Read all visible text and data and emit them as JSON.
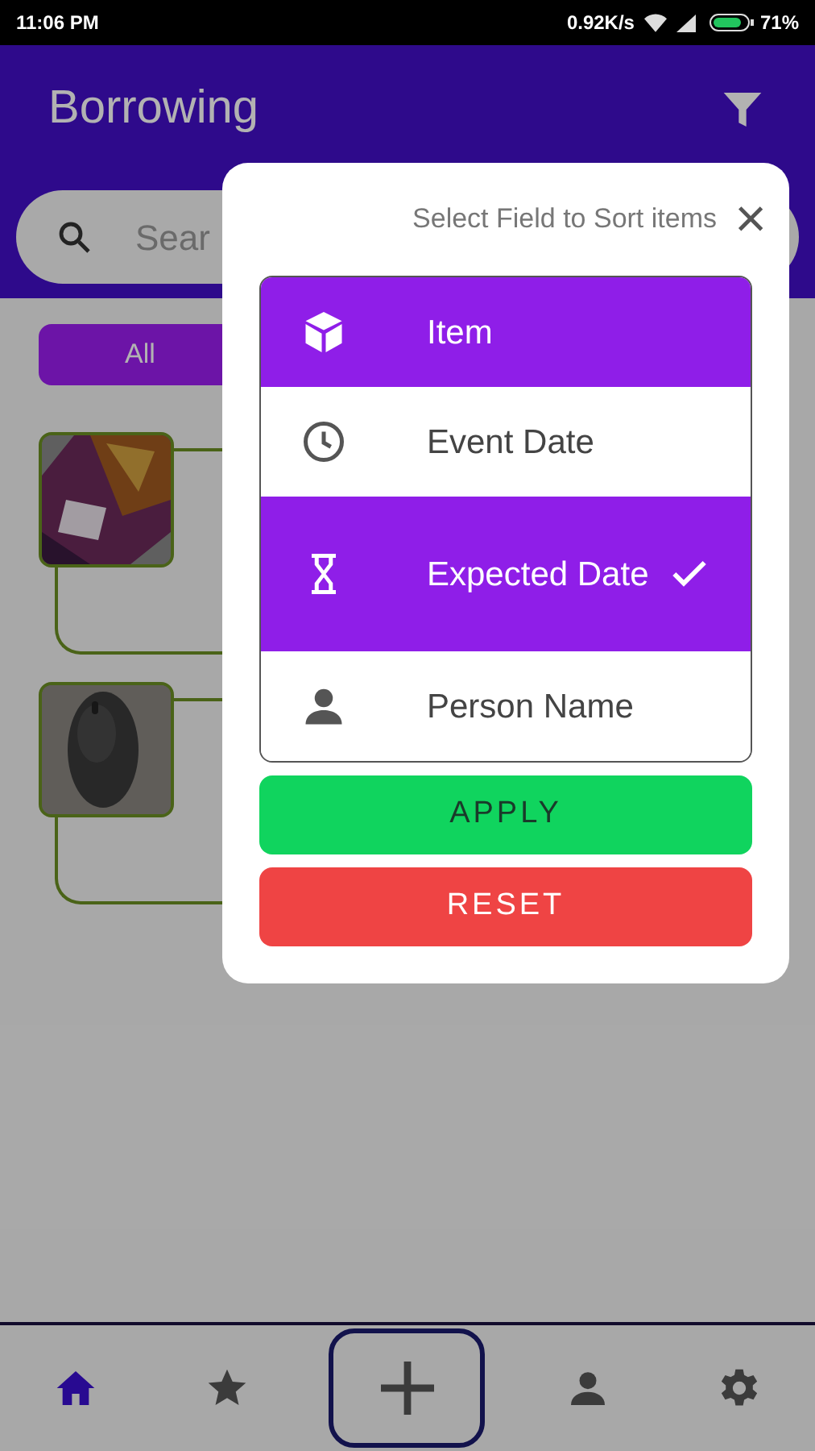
{
  "status_bar": {
    "time": "11:06 PM",
    "speed": "0.92K/s",
    "battery": "71%"
  },
  "app_bar": {
    "title": "Borrowing"
  },
  "search": {
    "placeholder": "Sear"
  },
  "chips": [
    {
      "label": "All",
      "selected": true
    }
  ],
  "dialog": {
    "title": "Select Field to Sort items",
    "close": "×",
    "options": [
      {
        "label": "Item",
        "kind": "cube",
        "highlighted": true,
        "checked": false
      },
      {
        "label": "Event Date",
        "kind": "clock",
        "highlighted": false,
        "checked": false
      },
      {
        "label": "Expected Date",
        "kind": "hourglass",
        "highlighted": true,
        "checked": true
      },
      {
        "label": "Person Name",
        "kind": "person",
        "highlighted": false,
        "checked": false
      }
    ],
    "apply": "APPLY",
    "reset": "RESET"
  },
  "bottom_nav": [
    {
      "kind": "home",
      "selected": true
    },
    {
      "kind": "star",
      "selected": false
    },
    {
      "kind": "plus",
      "selected": false
    },
    {
      "kind": "person",
      "selected": false
    },
    {
      "kind": "gear",
      "selected": false
    }
  ]
}
